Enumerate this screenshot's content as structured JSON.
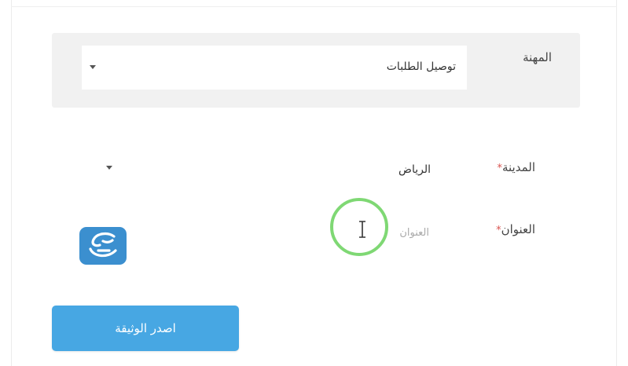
{
  "form": {
    "profession": {
      "label": "المهنة",
      "value": "توصيل الطلبات"
    },
    "city": {
      "label": "المدينة",
      "required_mark": "*",
      "value": "الرياض"
    },
    "address": {
      "label": "العنوان",
      "required_mark": "*",
      "placeholder": "العنوان",
      "value": ""
    },
    "submit_label": "اصدر الوثيقة"
  },
  "colors": {
    "primary_button": "#47a7e3",
    "required": "#d9534f",
    "cursor_highlight": "#7fd874",
    "logo_bg": "#3b8fcf"
  },
  "icons": [
    "dropdown-caret-icon",
    "text-cursor-icon",
    "site-logo-icon"
  ]
}
